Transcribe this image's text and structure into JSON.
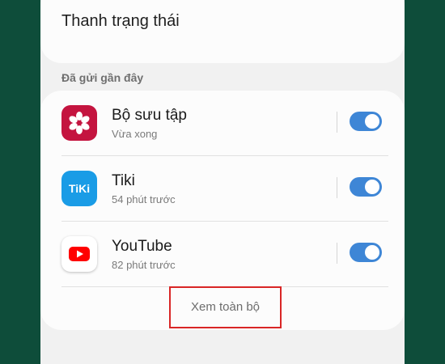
{
  "status_bar_item": {
    "label": "Thanh trạng thái"
  },
  "recent": {
    "header": "Đã gửi gần đây",
    "apps": [
      {
        "name": "Bộ sưu tập",
        "time": "Vừa xong",
        "icon": "gallery-flower-icon",
        "enabled": true
      },
      {
        "name": "Tiki",
        "time": "54 phút trước",
        "icon": "tiki-icon",
        "icon_text": "TiKi",
        "enabled": true
      },
      {
        "name": "YouTube",
        "time": "82 phút trước",
        "icon": "youtube-icon",
        "enabled": true
      }
    ],
    "view_all": "Xem toàn bộ"
  },
  "colors": {
    "background": "#0e4d3a",
    "toggle_on": "#3e86d6",
    "gallery": "#c4143f",
    "tiki": "#1a9ce6",
    "youtube": "#ff0000",
    "highlight_box": "#d92626"
  }
}
